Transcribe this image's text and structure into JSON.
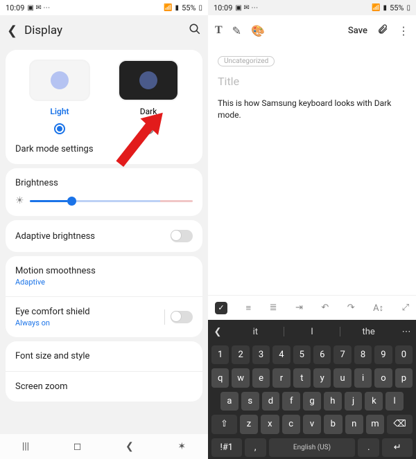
{
  "status": {
    "time": "10:09",
    "battery": "55%"
  },
  "settings": {
    "header_title": "Display",
    "light_label": "Light",
    "dark_label": "Dark",
    "dark_mode_settings": "Dark mode settings",
    "brightness_label": "Brightness",
    "adaptive_brightness": "Adaptive brightness",
    "motion_smoothness": "Motion smoothness",
    "motion_sub": "Adaptive",
    "eye_comfort": "Eye comfort shield",
    "eye_sub": "Always on",
    "font_size_style": "Font size and style",
    "screen_zoom": "Screen zoom"
  },
  "notes": {
    "text_tool": "T",
    "save_label": "Save",
    "category": "Uncategorized",
    "title_placeholder": "Title",
    "body": "This is how Samsung keyboard looks with Dark mode."
  },
  "keyboard": {
    "suggestions": [
      "it",
      "I",
      "the"
    ],
    "num_row": [
      "1",
      "2",
      "3",
      "4",
      "5",
      "6",
      "7",
      "8",
      "9",
      "0"
    ],
    "row1": [
      "q",
      "w",
      "e",
      "r",
      "t",
      "y",
      "u",
      "i",
      "o",
      "p"
    ],
    "row2": [
      "a",
      "s",
      "d",
      "f",
      "g",
      "h",
      "j",
      "k",
      "l"
    ],
    "row3_mid": [
      "z",
      "x",
      "c",
      "v",
      "b",
      "n",
      "m"
    ],
    "sym": "!#1",
    "comma": ",",
    "space": "English (US)",
    "period": "."
  }
}
